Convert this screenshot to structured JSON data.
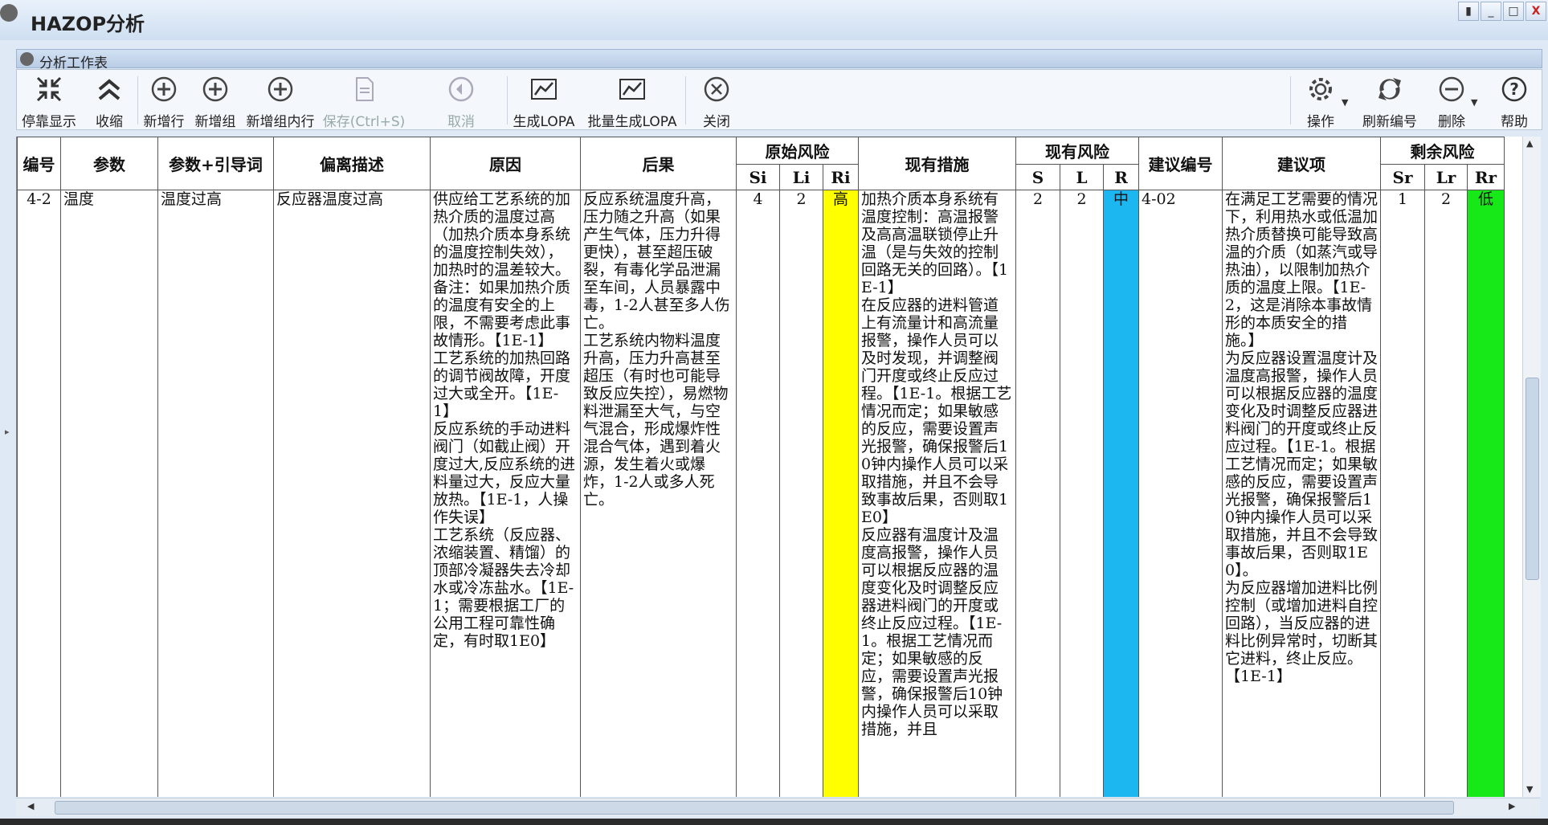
{
  "window": {
    "title": "HAZOP分析",
    "pin": "▮",
    "minimize": "_",
    "maximize": "□",
    "close": "X"
  },
  "panel": {
    "title": "分析工作表"
  },
  "toolbar": {
    "dock": "停靠显示",
    "collapse": "收缩",
    "add_row": "新增行",
    "add_group": "新增组",
    "add_in_group": "新增组内行",
    "save": "保存(Ctrl+S)",
    "cancel": "取消",
    "gen_lopa": "生成LOPA",
    "batch_lopa": "批量生成LOPA",
    "close": "关闭",
    "operate": "操作",
    "renumber": "刷新编号",
    "delete": "删除",
    "help": "帮助"
  },
  "table": {
    "headers": {
      "id": "编号",
      "param": "参数",
      "param_guide": "参数+引导词",
      "deviation": "偏离描述",
      "cause": "原因",
      "consequence": "后果",
      "orig_risk": "原始风险",
      "si": "Si",
      "li": "Li",
      "ri": "Ri",
      "measures": "现有措施",
      "cur_risk": "现有风险",
      "s": "S",
      "l": "L",
      "r": "R",
      "rec_id": "建议编号",
      "rec": "建议项",
      "res_risk": "剩余风险",
      "sr": "Sr",
      "lr": "Lr",
      "rr": "Rr"
    },
    "rows": [
      {
        "id": "4-2",
        "param": "温度",
        "param_guide": "温度过高",
        "deviation": "反应器温度过高",
        "cause": "供应给工艺系统的加热介质的温度过高（加热介质本身系统的温度控制失效），加热时的温差较大。备注：如果加热介质的温度有安全的上限，不需要考虑此事故情形。【1E-1】\n工艺系统的加热回路的调节阀故障，开度过大或全开。【1E-1】\n反应系统的手动进料阀门（如截止阀）开度过大,反应系统的进料量过大，反应大量放热。【1E-1，人操作失误】\n工艺系统（反应器、浓缩装置、精馏）的顶部冷凝器失去冷却水或冷冻盐水。【1E-1；需要根据工厂的公用工程可靠性确定，有时取1E0】",
        "consequence": "反应系统温度升高，压力随之升高（如果产生气体，压力升得更快），甚至超压破裂，有毒化学品泄漏至车间，人员暴露中毒，1-2人甚至多人伤亡。\n工艺系统内物料温度升高，压力升高甚至超压（有时也可能导致反应失控），易燃物料泄漏至大气，与空气混合，形成爆炸性混合气体，遇到着火源，发生着火或爆炸，1-2人或多人死亡。",
        "si": "4",
        "li": "2",
        "ri": "高",
        "measures": "加热介质本身系统有温度控制：高温报警及高高温联锁停止升温（是与失效的控制回路无关的回路）。【1E-1】\n在反应器的进料管道上有流量计和高流量报警，操作人员可以及时发现，并调整阀门开度或终止反应过程。【1E-1。根据工艺情况而定；如果敏感的反应，需要设置声光报警，确保报警后10钟内操作人员可以采取措施，并且不会导致事故后果，否则取1E0】\n反应器有温度计及温度高报警，操作人员可以根据反应器的温度变化及时调整反应器进料阀门的开度或终止反应过程。【1E-1。根据工艺情况而定；如果敏感的反应，需要设置声光报警，确保报警后10钟内操作人员可以采取措施，并且",
        "s": "2",
        "l": "2",
        "r": "中",
        "rec_id": "4-02",
        "rec": "在满足工艺需要的情况下，利用热水或低温加热介质替换可能导致高温的介质（如蒸汽或导热油），以限制加热介质的温度上限。【1E-2，这是消除本事故情形的本质安全的措施。】\n为反应器设置温度计及温度高报警，操作人员可以根据反应器的温度变化及时调整反应器进料阀门的开度或终止反应过程。【1E-1。根据工艺情况而定；如果敏感的反应，需要设置声光报警，确保报警后10钟内操作人员可以采取措施，并且不会导致事故后果，否则取1E0】。\n为反应器增加进料比例控制（或增加进料自控回路），当反应器的进料比例异常时，切断其它进料，终止反应。【1E-1】",
        "sr": "1",
        "lr": "2",
        "rr": "低"
      }
    ]
  },
  "colors": {
    "high": "#ffff00",
    "medium": "#1cb6f0",
    "low": "#17e817"
  }
}
